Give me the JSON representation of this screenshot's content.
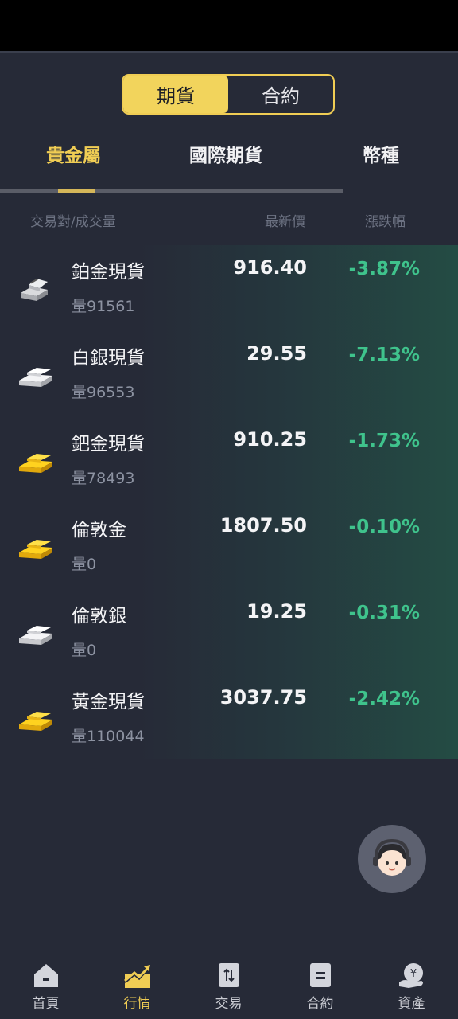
{
  "segment": {
    "futures_label": "期貨",
    "contract_label": "合約",
    "selected": "futures"
  },
  "categories": [
    {
      "label": "貴金屬",
      "active": true
    },
    {
      "label": "國際期貨",
      "active": false
    },
    {
      "label": "幣種",
      "active": false
    }
  ],
  "columns": {
    "pair_volume": "交易對/成交量",
    "last_price": "最新價",
    "change_pct": "漲跌幅"
  },
  "rows": [
    {
      "name": "鉑金現貨",
      "volume": "量91561",
      "price": "916.40",
      "change": "-3.87%",
      "icon": "platinum-bars-icon"
    },
    {
      "name": "白銀現貨",
      "volume": "量96553",
      "price": "29.55",
      "change": "-7.13%",
      "icon": "silver-bars-icon"
    },
    {
      "name": "鈀金現貨",
      "volume": "量78493",
      "price": "910.25",
      "change": "-1.73%",
      "icon": "gold-bars-icon"
    },
    {
      "name": "倫敦金",
      "volume": "量0",
      "price": "1807.50",
      "change": "-0.10%",
      "icon": "gold-bars-icon"
    },
    {
      "name": "倫敦銀",
      "volume": "量0",
      "price": "19.25",
      "change": "-0.31%",
      "icon": "silver-bars-icon"
    },
    {
      "name": "黃金現貨",
      "volume": "量110044",
      "price": "3037.75",
      "change": "-2.42%",
      "icon": "gold-bars-icon"
    }
  ],
  "colors": {
    "accent": "#f0cd54",
    "negative_change": "#3fc38c",
    "background": "#262a37"
  },
  "bottom_nav": [
    {
      "label": "首頁",
      "icon": "home-icon",
      "active": false
    },
    {
      "label": "行情",
      "icon": "market-chart-icon",
      "active": true
    },
    {
      "label": "交易",
      "icon": "trade-icon",
      "active": false
    },
    {
      "label": "合約",
      "icon": "contract-icon",
      "active": false
    },
    {
      "label": "資產",
      "icon": "assets-icon",
      "active": false
    }
  ]
}
